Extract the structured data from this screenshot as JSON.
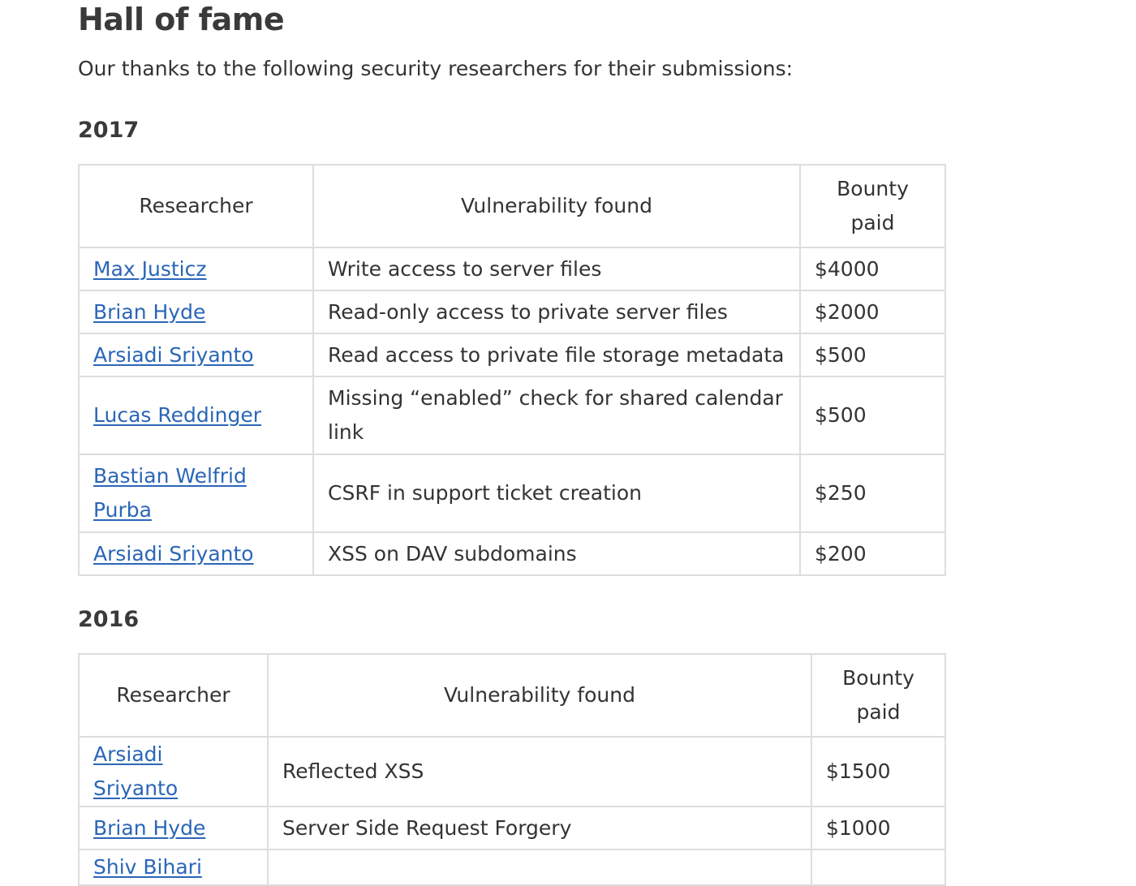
{
  "page": {
    "title": "Hall of fame",
    "intro": "Our thanks to the following security researchers for their submissions:"
  },
  "columns": {
    "researcher": "Researcher",
    "vulnerability": "Vulnerability found",
    "bounty_line1": "Bounty",
    "bounty_line2": "paid"
  },
  "sections": [
    {
      "year": "2017",
      "rows": [
        {
          "researcher": "Max Justicz",
          "vulnerability": "Write access to server files",
          "bounty": "$4000"
        },
        {
          "researcher": "Brian Hyde",
          "vulnerability": "Read-only access to private server files",
          "bounty": "$2000"
        },
        {
          "researcher": "Arsiadi Sriyanto",
          "vulnerability": "Read access to private file storage metadata",
          "bounty": "$500"
        },
        {
          "researcher": "Lucas Reddinger",
          "vulnerability": "Missing “enabled” check for shared calendar link",
          "bounty": "$500"
        },
        {
          "researcher": "Bastian Welfrid Purba",
          "vulnerability": "CSRF in support ticket creation",
          "bounty": "$250"
        },
        {
          "researcher": "Arsiadi Sriyanto",
          "vulnerability": "XSS on DAV subdomains",
          "bounty": "$200"
        }
      ]
    },
    {
      "year": "2016",
      "rows": [
        {
          "researcher": "Arsiadi Sriyanto",
          "vulnerability": "Reflected XSS",
          "bounty": "$1500"
        },
        {
          "researcher": "Brian Hyde",
          "vulnerability": "Server Side Request Forgery",
          "bounty": "$1000"
        },
        {
          "researcher": "Shiv Bihari",
          "vulnerability": "",
          "bounty": ""
        }
      ]
    }
  ]
}
